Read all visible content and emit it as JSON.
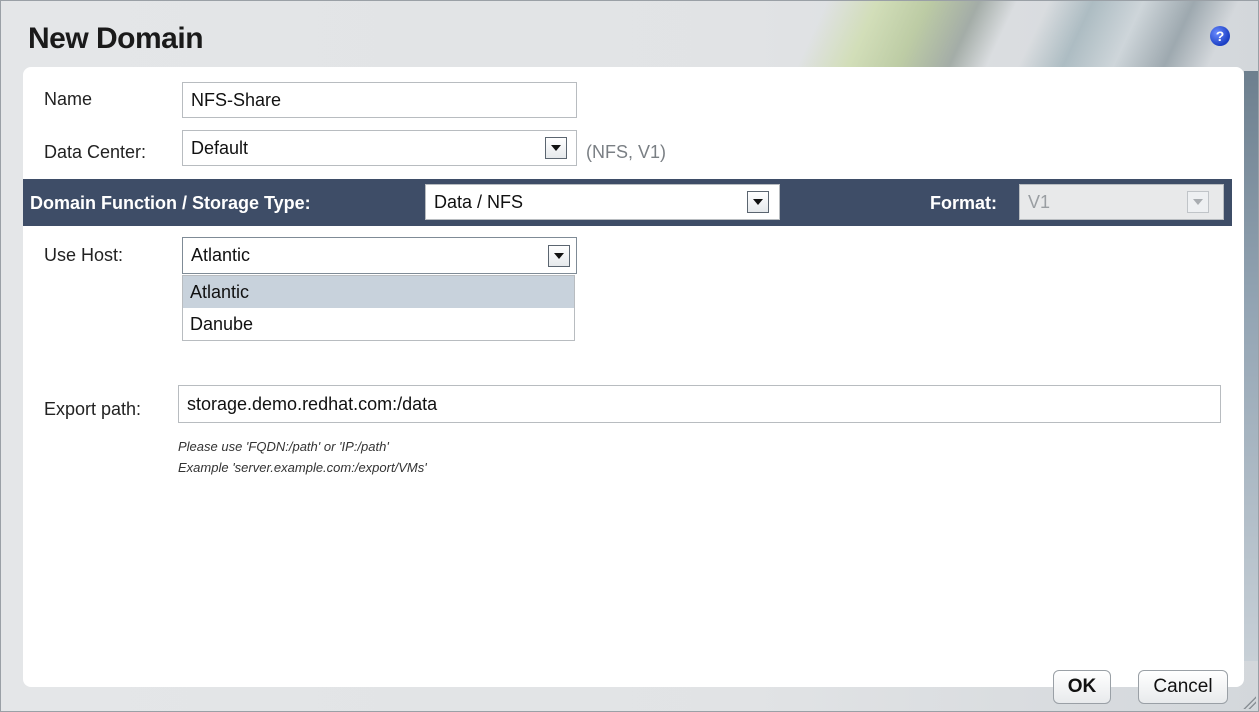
{
  "dialog": {
    "title": "New Domain",
    "help_icon": "?"
  },
  "form": {
    "name_label": "Name",
    "name_value": "NFS-Share",
    "data_center_label": "Data Center:",
    "data_center_value": "Default",
    "data_center_hint": "(NFS, V1)",
    "domain_function_label": "Domain Function / Storage Type:",
    "domain_function_value": "Data  / NFS",
    "format_label": "Format:",
    "format_value": "V1",
    "use_host_label": "Use Host:",
    "use_host_value": "Atlantic",
    "host_options": [
      "Atlantic",
      "Danube"
    ],
    "export_path_label": "Export path:",
    "export_path_value": "storage.demo.redhat.com:/data",
    "hint_line1": "Please use 'FQDN:/path' or 'IP:/path'",
    "hint_line2": "Example 'server.example.com:/export/VMs'"
  },
  "buttons": {
    "ok": "OK",
    "cancel": "Cancel"
  },
  "colors": {
    "bar": "#3e4d67",
    "selected_option": "#c8d2dc",
    "help_icon": "#1b3fc4"
  }
}
